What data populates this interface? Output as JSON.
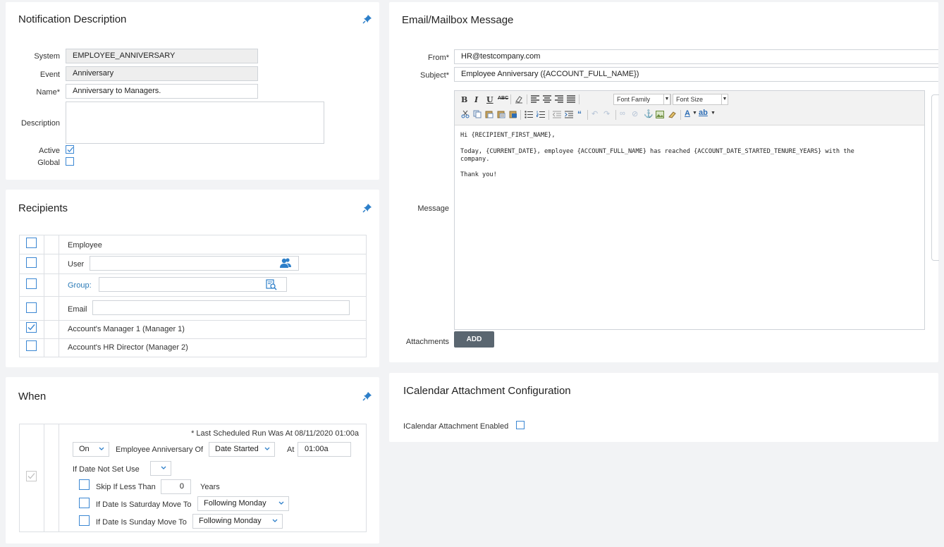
{
  "notification": {
    "title": "Notification Description",
    "system_label": "System",
    "system_value": "EMPLOYEE_ANNIVERSARY",
    "event_label": "Event",
    "event_value": "Anniversary",
    "name_label": "Name*",
    "name_value": "Anniversary to Managers.",
    "description_label": "Description",
    "description_value": "",
    "active_label": "Active",
    "active_checked": true,
    "global_label": "Global",
    "global_checked": false
  },
  "recipients": {
    "title": "Recipients",
    "rows": [
      {
        "label": "Employee",
        "checked": false
      },
      {
        "label": "User",
        "checked": false
      },
      {
        "label": "Group:",
        "checked": false
      },
      {
        "label": "Email",
        "checked": false
      },
      {
        "label": "Account's Manager 1 (Manager 1)",
        "checked": true
      },
      {
        "label": "Account's HR Director (Manager 2)",
        "checked": false
      }
    ]
  },
  "when": {
    "title": "When",
    "last_run": "* Last Scheduled Run Was At 08/11/2020 01:00a",
    "on_value": "On",
    "anniversary_label": "Employee Anniversary Of",
    "date_field_value": "Date Started",
    "at_label": "At",
    "time_value": "01:00a",
    "if_not_set_label": "If Date Not Set Use",
    "if_not_set_value": "",
    "skip_label": "Skip If Less Than",
    "skip_value": "0",
    "years_label": "Years",
    "saturday_label": "If Date Is Saturday Move To",
    "saturday_value": "Following Monday",
    "sunday_label": "If Date Is Sunday Move To",
    "sunday_value": "Following Monday"
  },
  "email": {
    "title": "Email/Mailbox Message",
    "from_label": "From*",
    "from_value": "HR@testcompany.com",
    "subject_label": "Subject*",
    "subject_value": "Employee Anniversary ({ACCOUNT_FULL_NAME})",
    "message_label": "Message",
    "font_family": "Font Family",
    "font_size": "Font Size",
    "body_lines": [
      "Hi {RECIPIENT_FIRST_NAME},",
      "Today, {CURRENT_DATE}, employee {ACCOUNT_FULL_NAME} has reached {ACCOUNT_DATE_STARTED_TENURE_YEARS} with the",
      "company.",
      "Thank you!"
    ],
    "attachments_label": "Attachments",
    "add_button": "ADD"
  },
  "icalendar": {
    "title": "ICalendar Attachment Configuration",
    "enabled_label": "ICalendar Attachment Enabled",
    "enabled_checked": false
  },
  "colors": {
    "accent": "#3b87d3",
    "link": "#2a7ab7",
    "button": "#5a6670"
  }
}
